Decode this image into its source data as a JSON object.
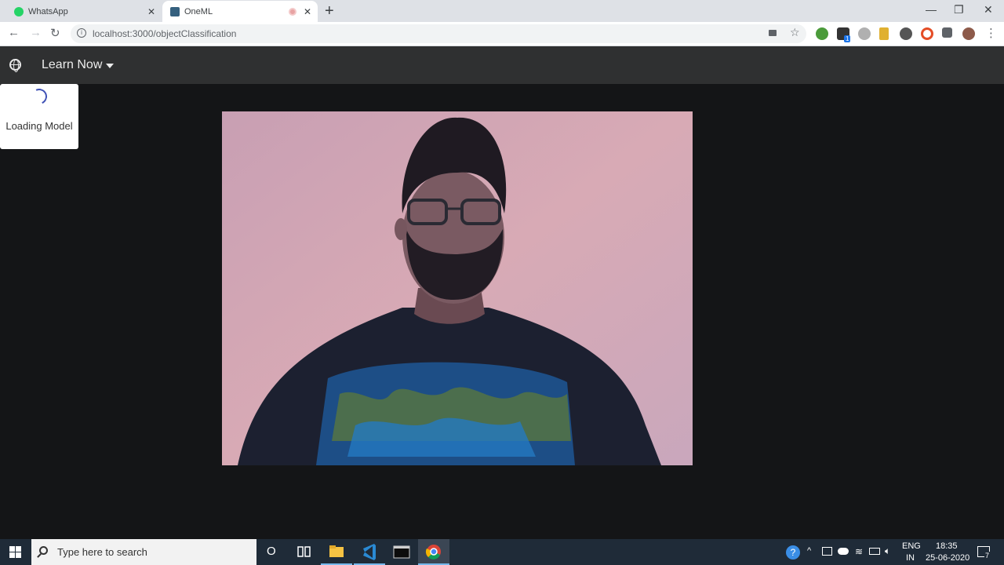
{
  "browser": {
    "tabs": [
      {
        "title": "WhatsApp",
        "close": "✕"
      },
      {
        "title": "OneML",
        "close": "✕"
      }
    ],
    "new_tab": "+",
    "window_controls": {
      "minimize": "—",
      "restore": "❐",
      "close": "✕"
    },
    "nav": {
      "back": "←",
      "forward": "→",
      "reload": "↻"
    },
    "address": "localhost:3000/objectClassification",
    "star": "☆",
    "extension_badge": "1",
    "menu": "⋮"
  },
  "app": {
    "menu_label": "Learn Now",
    "globe_icon": "globe-icon",
    "loading_text": "Loading Model",
    "accent": "#3f51b5",
    "appbar_color": "#2f3031",
    "background": "#141517"
  },
  "taskbar": {
    "search_placeholder": "Type here to search",
    "cortana": "O",
    "language_top": "ENG",
    "language_bottom": "IN",
    "time": "18:35",
    "date": "25-06-2020",
    "notification_count": "7"
  }
}
